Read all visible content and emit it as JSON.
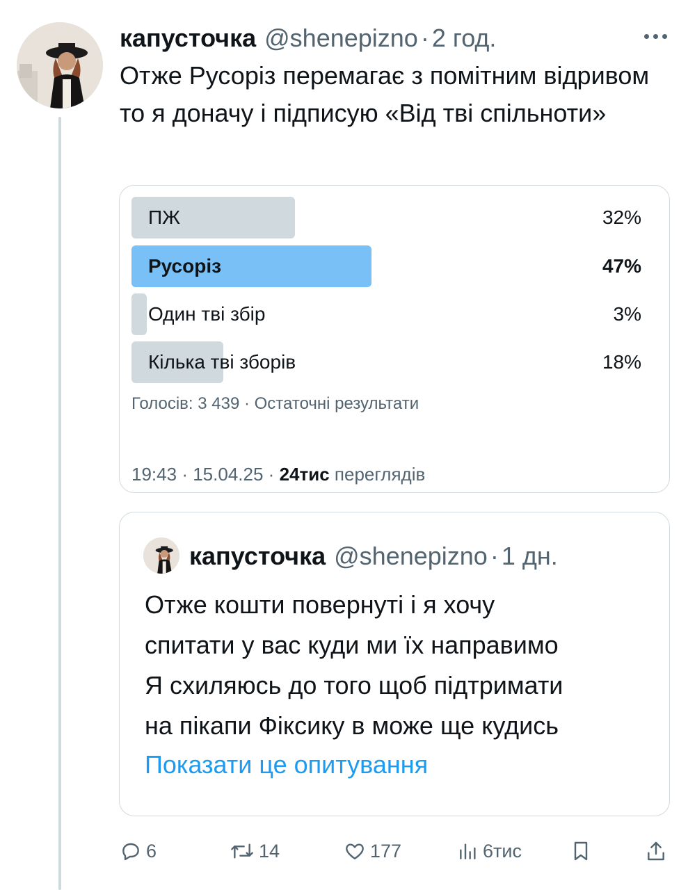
{
  "tweet": {
    "author_name": "капусточка",
    "handle": "@shenepizno",
    "separator": "·",
    "time": "2 год.",
    "text": "Отже Русоріз перемагає з помітним відривом то я доначу і підписую «Від тві спільноти»"
  },
  "poll": {
    "options": [
      {
        "label": "ПЖ",
        "percent": 32,
        "percent_text": "32%",
        "winner": false
      },
      {
        "label": "Русоріз",
        "percent": 47,
        "percent_text": "47%",
        "winner": true
      },
      {
        "label": "Один тві збір",
        "percent": 3,
        "percent_text": "3%",
        "winner": false
      },
      {
        "label": "Кілька тві зборів",
        "percent": 18,
        "percent_text": "18%",
        "winner": false
      }
    ],
    "meta": "Голосів: 3 439 · Остаточні результати"
  },
  "tweet_meta": {
    "time": "19:43",
    "date": "15.04.25",
    "views_count": "24тис",
    "views_label": "переглядів",
    "separator": "·"
  },
  "quote": {
    "author_name": "капусточка",
    "handle": "@shenepizno",
    "separator": "·",
    "time": "1 дн.",
    "lines": [
      "Отже кошти повернуті і я хочу",
      "спитати у вас куди ми їх направимо",
      "Я схиляюсь до того щоб підтримати",
      "на пікапи Фіксику в може ще кудись"
    ],
    "show_poll_link": "Показати це опитування"
  },
  "actions": {
    "replies": "6",
    "reposts": "14",
    "likes": "177",
    "views": "6тис"
  },
  "colors": {
    "accent": "#1d9bf0",
    "winner_bar": "#78c0f5",
    "bar": "#cfd9de",
    "muted_text": "#536471"
  },
  "icons": [
    "more-icon",
    "reply-icon",
    "repost-icon",
    "like-icon",
    "views-icon",
    "bookmark-icon",
    "share-icon"
  ]
}
